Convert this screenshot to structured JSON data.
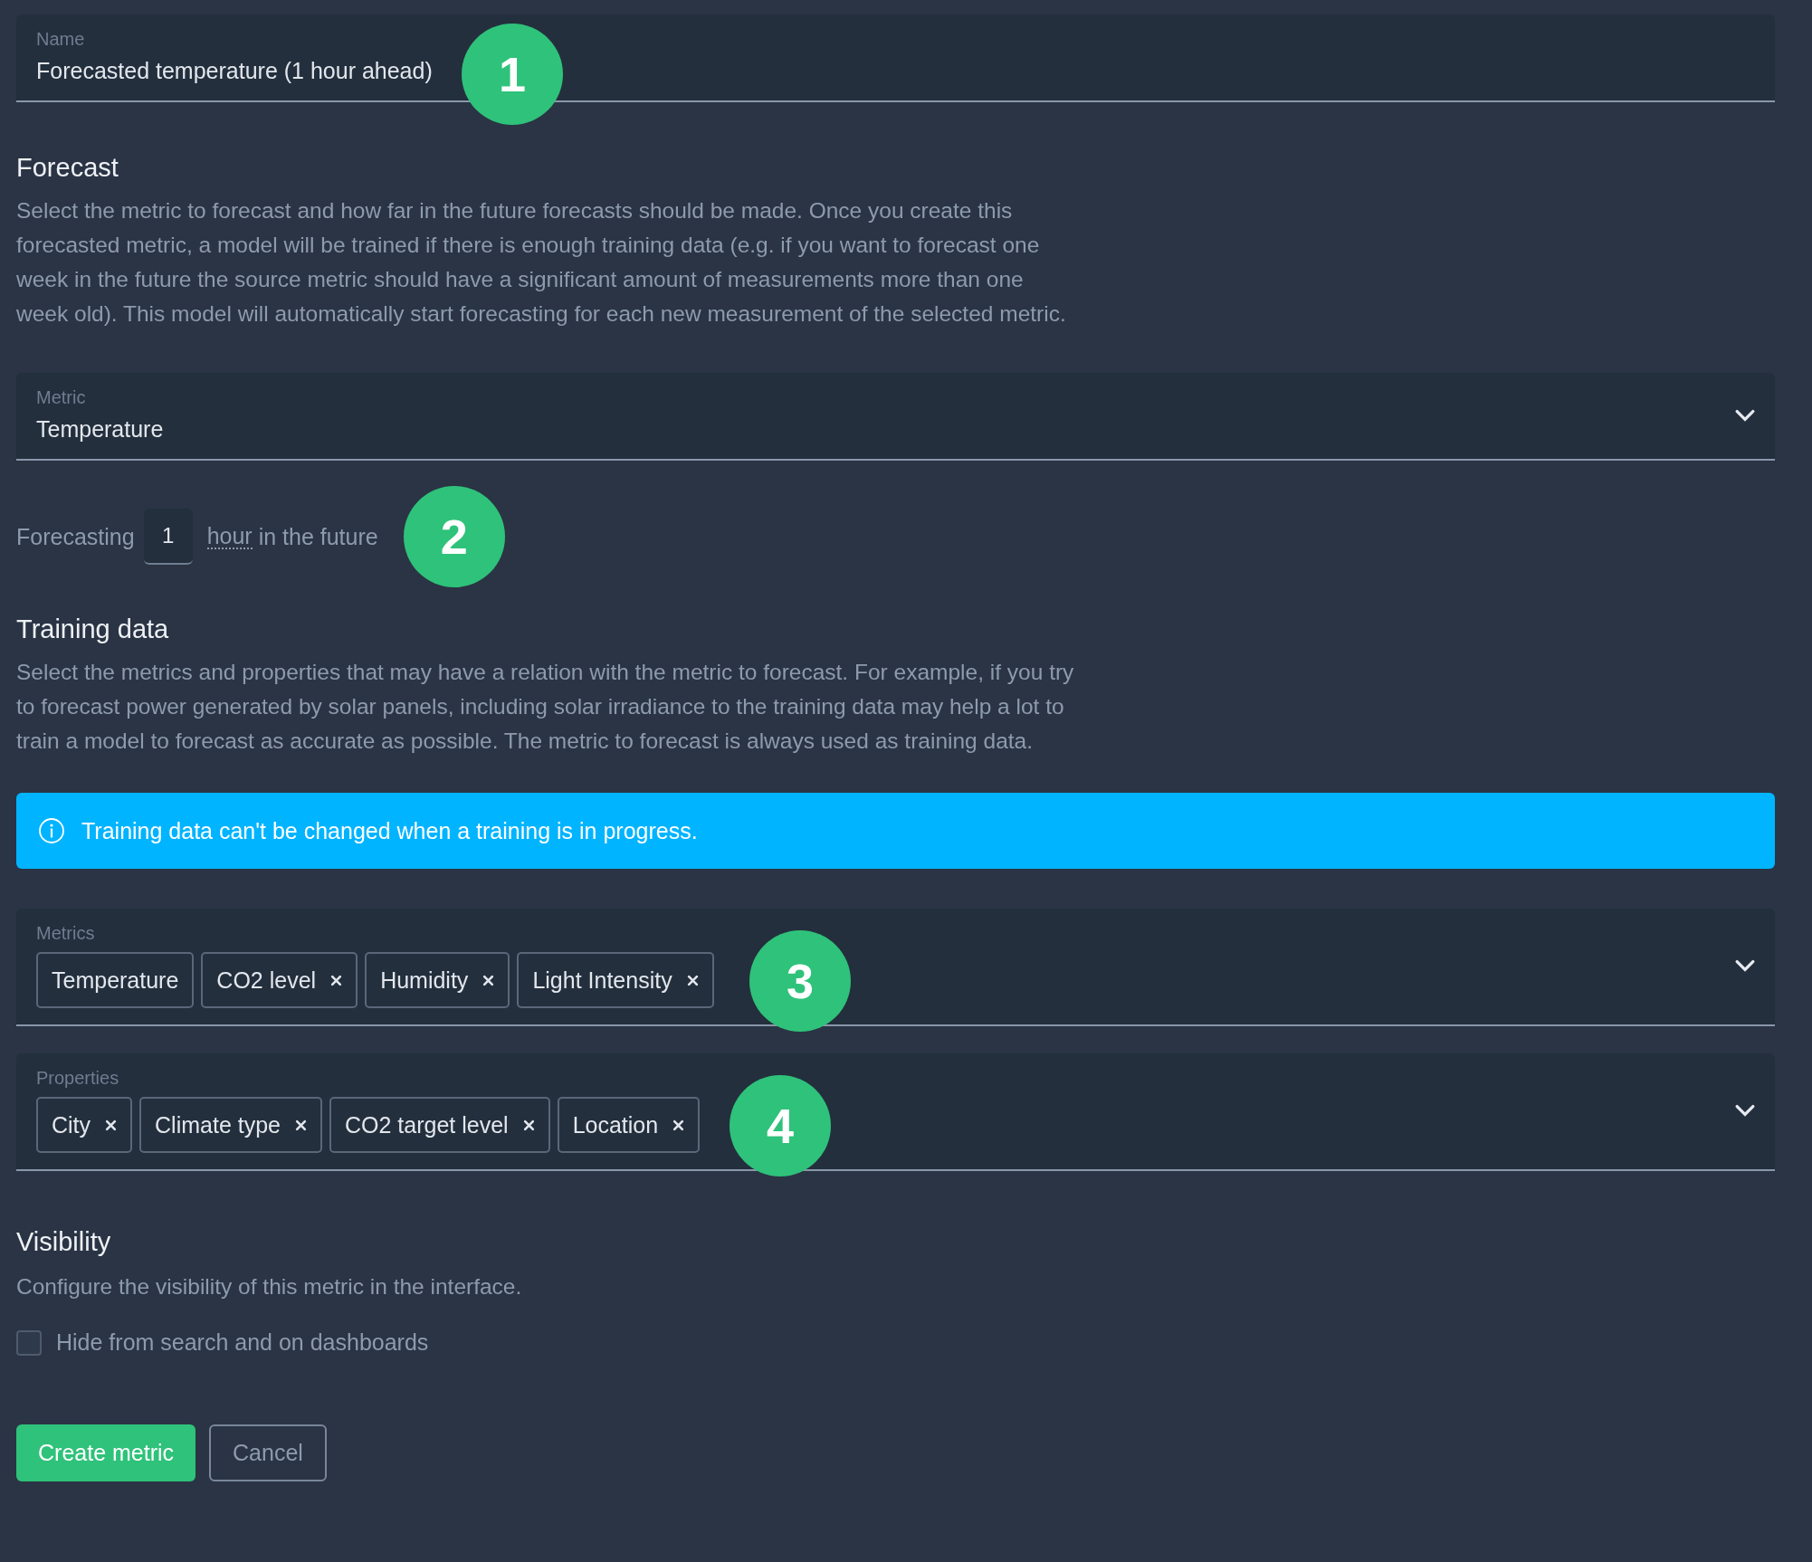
{
  "name_field": {
    "label": "Name",
    "value": "Forecasted temperature (1 hour ahead)",
    "callout": "1"
  },
  "forecast": {
    "heading": "Forecast",
    "description": "Select the metric to forecast and how far in the future forecasts should be made. Once you create this forecasted metric, a model will be trained if there is enough training data (e.g. if you want to forecast one week in the future the source metric should have a significant amount of measurements more than one week old). This model will automatically start forecasting for each new measurement of the selected metric."
  },
  "metric_field": {
    "label": "Metric",
    "value": "Temperature"
  },
  "forecasting": {
    "prefix": "Forecasting",
    "value": "1",
    "unit": "hour",
    "suffix": "in the future",
    "callout": "2"
  },
  "training": {
    "heading": "Training data",
    "description": "Select the metrics and properties that may have a relation with the metric to forecast. For example, if you try to forecast power generated by solar panels, including solar irradiance to the training data may help a lot to train a model to forecast as accurate as possible. The metric to forecast is always used as training data.",
    "info": "Training data can't be changed when a training is in progress."
  },
  "metrics_field": {
    "label": "Metrics",
    "callout": "3",
    "tags": [
      {
        "label": "Temperature",
        "removable": false
      },
      {
        "label": "CO2 level",
        "removable": true
      },
      {
        "label": "Humidity",
        "removable": true
      },
      {
        "label": "Light Intensity",
        "removable": true
      }
    ]
  },
  "properties_field": {
    "label": "Properties",
    "callout": "4",
    "tags": [
      {
        "label": "City",
        "removable": true
      },
      {
        "label": "Climate type",
        "removable": true
      },
      {
        "label": "CO2 target level",
        "removable": true
      },
      {
        "label": "Location",
        "removable": true
      }
    ]
  },
  "visibility": {
    "heading": "Visibility",
    "description": "Configure the visibility of this metric in the interface.",
    "checkbox": {
      "label": "Hide from search and on dashboards",
      "checked": false
    }
  },
  "buttons": [
    {
      "label": "Create metric",
      "kind": "primary"
    },
    {
      "label": "Cancel",
      "kind": "secondary"
    }
  ]
}
